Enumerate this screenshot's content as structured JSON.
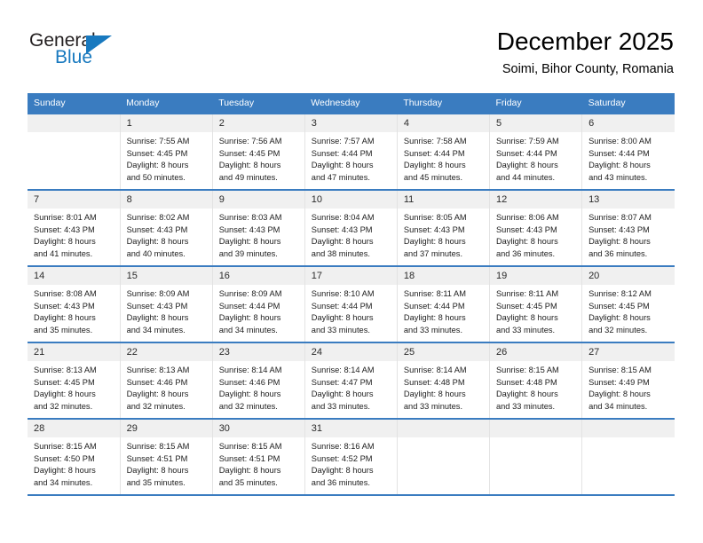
{
  "brand": {
    "name_part1": "General",
    "name_part2": "Blue",
    "logo_icon": "blue-triangle-icon",
    "accent_color": "#1879bf"
  },
  "header": {
    "title": "December 2025",
    "subtitle": "Soimi, Bihor County, Romania"
  },
  "calendar": {
    "header_color": "#3a7cc0",
    "weekdays": [
      "Sunday",
      "Monday",
      "Tuesday",
      "Wednesday",
      "Thursday",
      "Friday",
      "Saturday"
    ],
    "weeks": [
      [
        {
          "day": "",
          "sunrise": "",
          "sunset": "",
          "daylight1": "",
          "daylight2": ""
        },
        {
          "day": "1",
          "sunrise": "Sunrise: 7:55 AM",
          "sunset": "Sunset: 4:45 PM",
          "daylight1": "Daylight: 8 hours",
          "daylight2": "and 50 minutes."
        },
        {
          "day": "2",
          "sunrise": "Sunrise: 7:56 AM",
          "sunset": "Sunset: 4:45 PM",
          "daylight1": "Daylight: 8 hours",
          "daylight2": "and 49 minutes."
        },
        {
          "day": "3",
          "sunrise": "Sunrise: 7:57 AM",
          "sunset": "Sunset: 4:44 PM",
          "daylight1": "Daylight: 8 hours",
          "daylight2": "and 47 minutes."
        },
        {
          "day": "4",
          "sunrise": "Sunrise: 7:58 AM",
          "sunset": "Sunset: 4:44 PM",
          "daylight1": "Daylight: 8 hours",
          "daylight2": "and 45 minutes."
        },
        {
          "day": "5",
          "sunrise": "Sunrise: 7:59 AM",
          "sunset": "Sunset: 4:44 PM",
          "daylight1": "Daylight: 8 hours",
          "daylight2": "and 44 minutes."
        },
        {
          "day": "6",
          "sunrise": "Sunrise: 8:00 AM",
          "sunset": "Sunset: 4:44 PM",
          "daylight1": "Daylight: 8 hours",
          "daylight2": "and 43 minutes."
        }
      ],
      [
        {
          "day": "7",
          "sunrise": "Sunrise: 8:01 AM",
          "sunset": "Sunset: 4:43 PM",
          "daylight1": "Daylight: 8 hours",
          "daylight2": "and 41 minutes."
        },
        {
          "day": "8",
          "sunrise": "Sunrise: 8:02 AM",
          "sunset": "Sunset: 4:43 PM",
          "daylight1": "Daylight: 8 hours",
          "daylight2": "and 40 minutes."
        },
        {
          "day": "9",
          "sunrise": "Sunrise: 8:03 AM",
          "sunset": "Sunset: 4:43 PM",
          "daylight1": "Daylight: 8 hours",
          "daylight2": "and 39 minutes."
        },
        {
          "day": "10",
          "sunrise": "Sunrise: 8:04 AM",
          "sunset": "Sunset: 4:43 PM",
          "daylight1": "Daylight: 8 hours",
          "daylight2": "and 38 minutes."
        },
        {
          "day": "11",
          "sunrise": "Sunrise: 8:05 AM",
          "sunset": "Sunset: 4:43 PM",
          "daylight1": "Daylight: 8 hours",
          "daylight2": "and 37 minutes."
        },
        {
          "day": "12",
          "sunrise": "Sunrise: 8:06 AM",
          "sunset": "Sunset: 4:43 PM",
          "daylight1": "Daylight: 8 hours",
          "daylight2": "and 36 minutes."
        },
        {
          "day": "13",
          "sunrise": "Sunrise: 8:07 AM",
          "sunset": "Sunset: 4:43 PM",
          "daylight1": "Daylight: 8 hours",
          "daylight2": "and 36 minutes."
        }
      ],
      [
        {
          "day": "14",
          "sunrise": "Sunrise: 8:08 AM",
          "sunset": "Sunset: 4:43 PM",
          "daylight1": "Daylight: 8 hours",
          "daylight2": "and 35 minutes."
        },
        {
          "day": "15",
          "sunrise": "Sunrise: 8:09 AM",
          "sunset": "Sunset: 4:43 PM",
          "daylight1": "Daylight: 8 hours",
          "daylight2": "and 34 minutes."
        },
        {
          "day": "16",
          "sunrise": "Sunrise: 8:09 AM",
          "sunset": "Sunset: 4:44 PM",
          "daylight1": "Daylight: 8 hours",
          "daylight2": "and 34 minutes."
        },
        {
          "day": "17",
          "sunrise": "Sunrise: 8:10 AM",
          "sunset": "Sunset: 4:44 PM",
          "daylight1": "Daylight: 8 hours",
          "daylight2": "and 33 minutes."
        },
        {
          "day": "18",
          "sunrise": "Sunrise: 8:11 AM",
          "sunset": "Sunset: 4:44 PM",
          "daylight1": "Daylight: 8 hours",
          "daylight2": "and 33 minutes."
        },
        {
          "day": "19",
          "sunrise": "Sunrise: 8:11 AM",
          "sunset": "Sunset: 4:45 PM",
          "daylight1": "Daylight: 8 hours",
          "daylight2": "and 33 minutes."
        },
        {
          "day": "20",
          "sunrise": "Sunrise: 8:12 AM",
          "sunset": "Sunset: 4:45 PM",
          "daylight1": "Daylight: 8 hours",
          "daylight2": "and 32 minutes."
        }
      ],
      [
        {
          "day": "21",
          "sunrise": "Sunrise: 8:13 AM",
          "sunset": "Sunset: 4:45 PM",
          "daylight1": "Daylight: 8 hours",
          "daylight2": "and 32 minutes."
        },
        {
          "day": "22",
          "sunrise": "Sunrise: 8:13 AM",
          "sunset": "Sunset: 4:46 PM",
          "daylight1": "Daylight: 8 hours",
          "daylight2": "and 32 minutes."
        },
        {
          "day": "23",
          "sunrise": "Sunrise: 8:14 AM",
          "sunset": "Sunset: 4:46 PM",
          "daylight1": "Daylight: 8 hours",
          "daylight2": "and 32 minutes."
        },
        {
          "day": "24",
          "sunrise": "Sunrise: 8:14 AM",
          "sunset": "Sunset: 4:47 PM",
          "daylight1": "Daylight: 8 hours",
          "daylight2": "and 33 minutes."
        },
        {
          "day": "25",
          "sunrise": "Sunrise: 8:14 AM",
          "sunset": "Sunset: 4:48 PM",
          "daylight1": "Daylight: 8 hours",
          "daylight2": "and 33 minutes."
        },
        {
          "day": "26",
          "sunrise": "Sunrise: 8:15 AM",
          "sunset": "Sunset: 4:48 PM",
          "daylight1": "Daylight: 8 hours",
          "daylight2": "and 33 minutes."
        },
        {
          "day": "27",
          "sunrise": "Sunrise: 8:15 AM",
          "sunset": "Sunset: 4:49 PM",
          "daylight1": "Daylight: 8 hours",
          "daylight2": "and 34 minutes."
        }
      ],
      [
        {
          "day": "28",
          "sunrise": "Sunrise: 8:15 AM",
          "sunset": "Sunset: 4:50 PM",
          "daylight1": "Daylight: 8 hours",
          "daylight2": "and 34 minutes."
        },
        {
          "day": "29",
          "sunrise": "Sunrise: 8:15 AM",
          "sunset": "Sunset: 4:51 PM",
          "daylight1": "Daylight: 8 hours",
          "daylight2": "and 35 minutes."
        },
        {
          "day": "30",
          "sunrise": "Sunrise: 8:15 AM",
          "sunset": "Sunset: 4:51 PM",
          "daylight1": "Daylight: 8 hours",
          "daylight2": "and 35 minutes."
        },
        {
          "day": "31",
          "sunrise": "Sunrise: 8:16 AM",
          "sunset": "Sunset: 4:52 PM",
          "daylight1": "Daylight: 8 hours",
          "daylight2": "and 36 minutes."
        },
        {
          "day": "",
          "sunrise": "",
          "sunset": "",
          "daylight1": "",
          "daylight2": ""
        },
        {
          "day": "",
          "sunrise": "",
          "sunset": "",
          "daylight1": "",
          "daylight2": ""
        },
        {
          "day": "",
          "sunrise": "",
          "sunset": "",
          "daylight1": "",
          "daylight2": ""
        }
      ]
    ]
  }
}
